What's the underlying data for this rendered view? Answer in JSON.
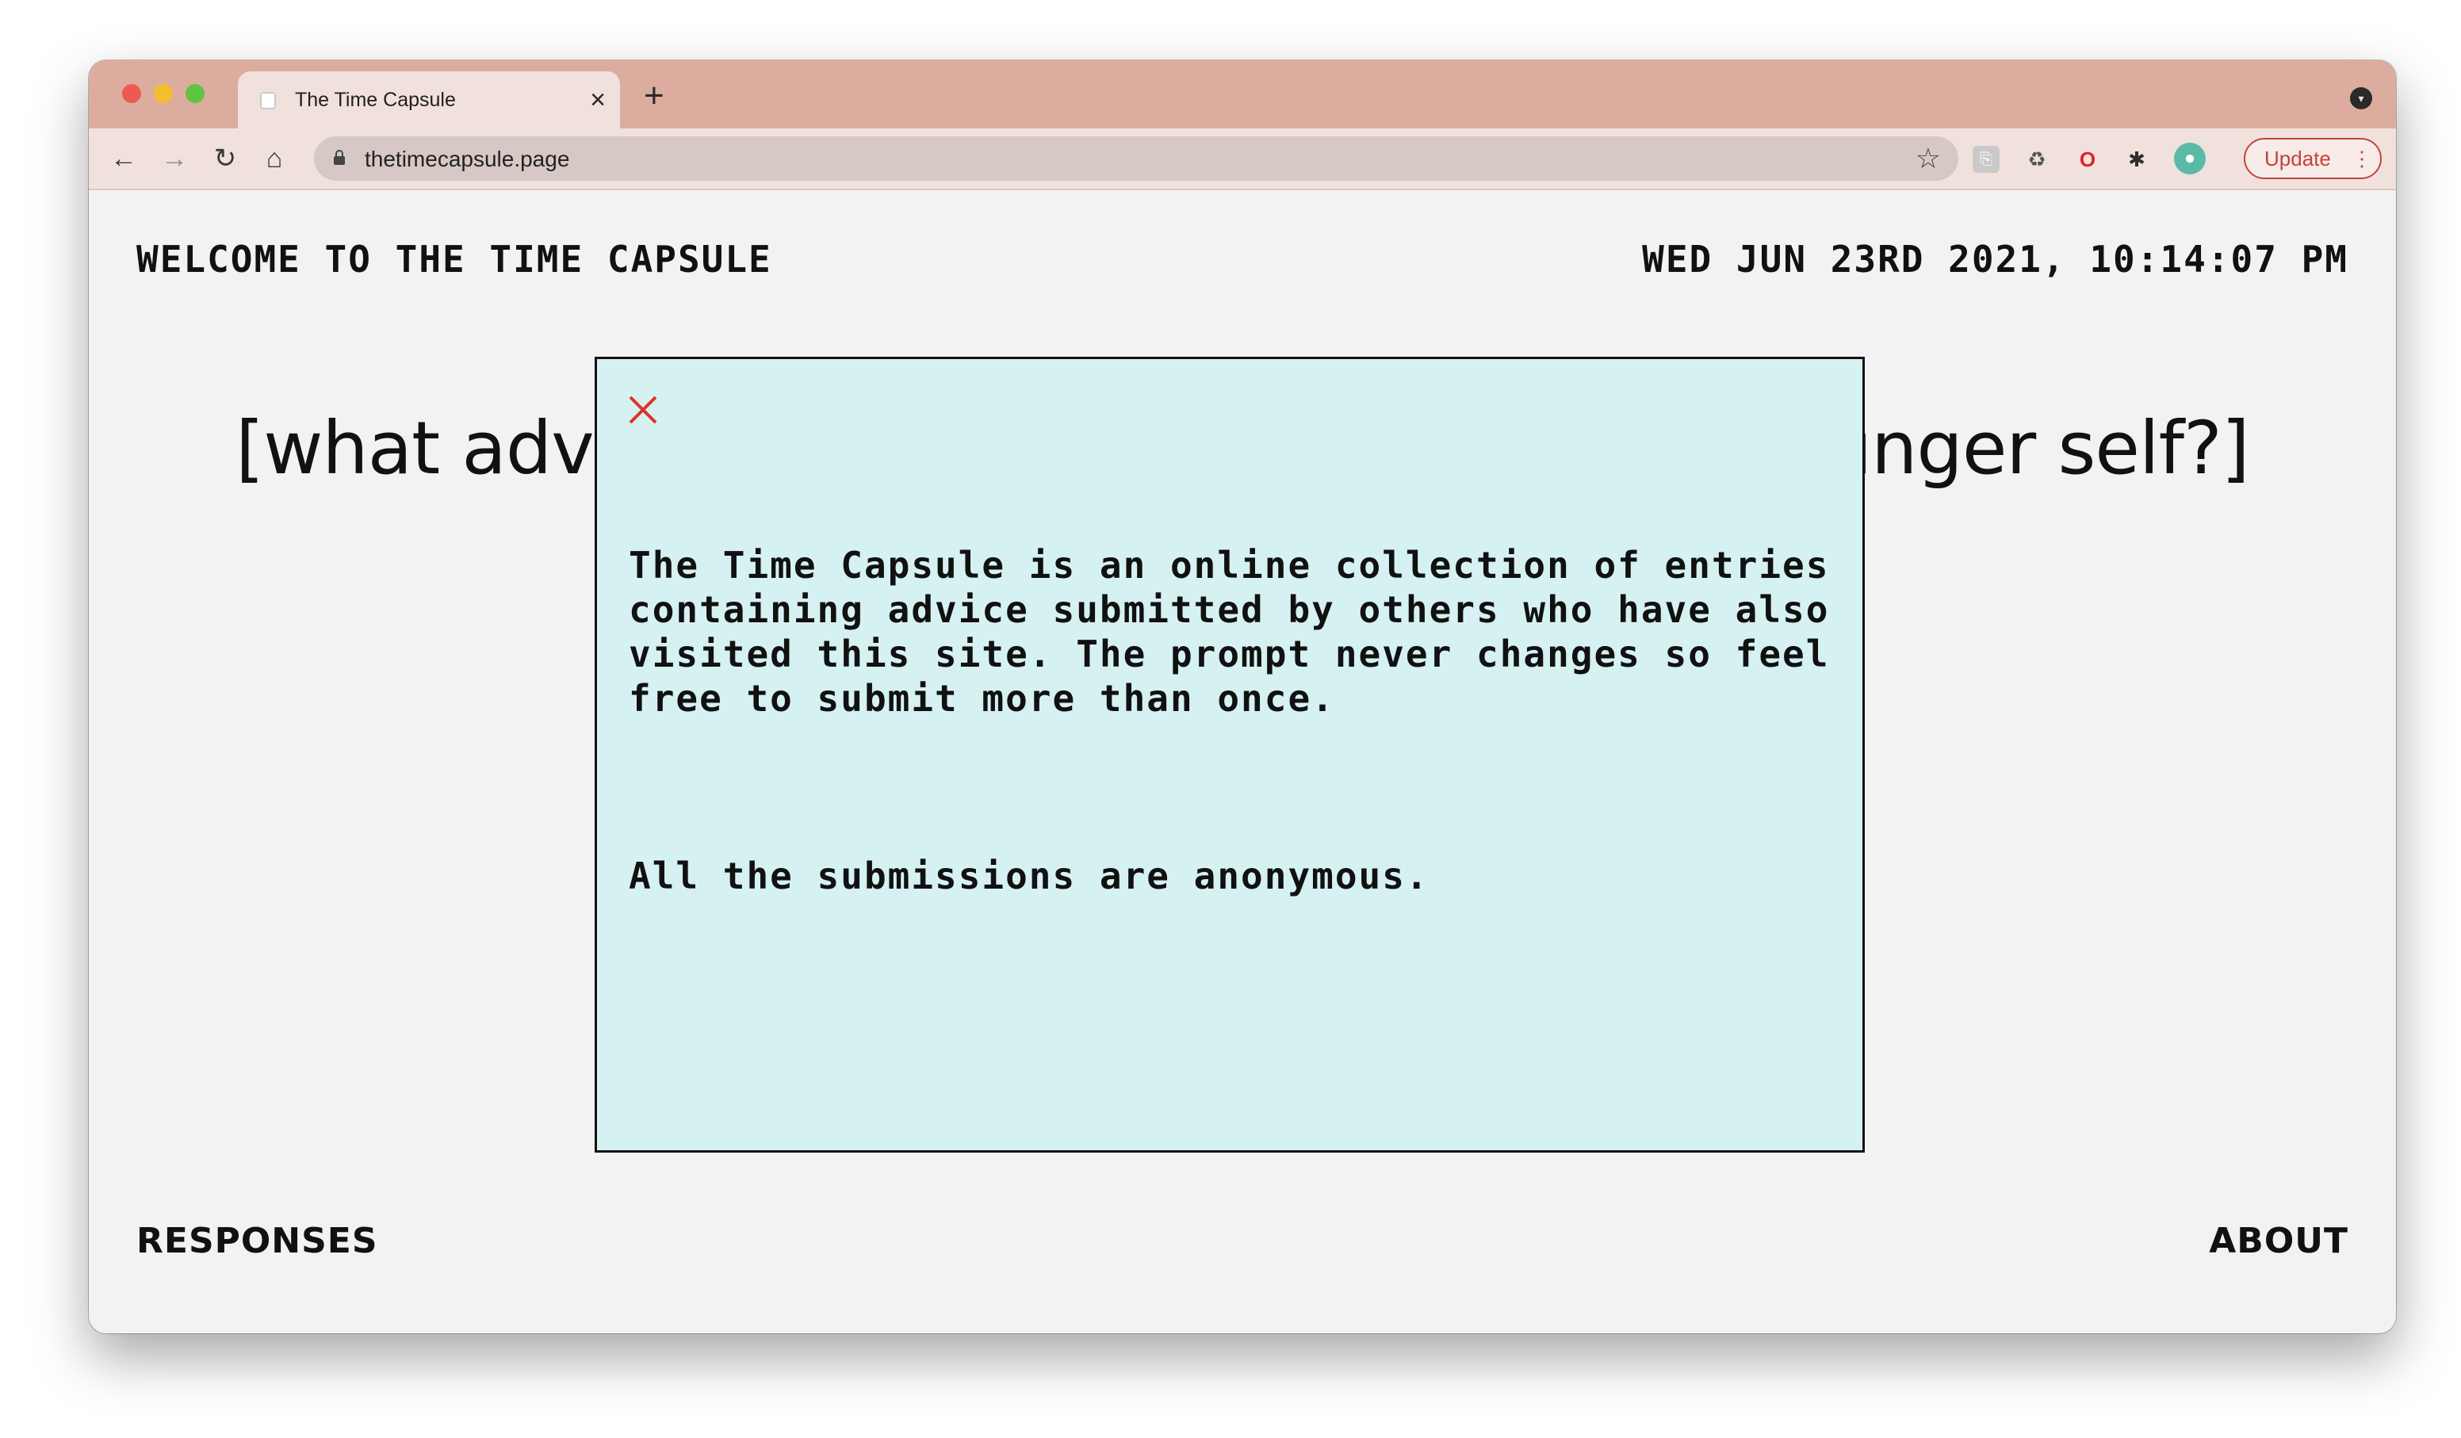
{
  "browser": {
    "tab_title": "The Time Capsule",
    "tab_close": "×",
    "new_tab": "+",
    "url": "thetimecapsule.page",
    "update_label": "Update",
    "update_menu": "⋮"
  },
  "page": {
    "title": "WELCOME TO THE TIME CAPSULE",
    "datetime": "WED JUN 23RD 2021, 10:14:07 PM",
    "prompt_left": "[what advic",
    "prompt_right": "unger self?]",
    "footer_left": "RESPONSES",
    "footer_right": "ABOUT"
  },
  "modal": {
    "paragraph_1": "The Time Capsule is an online collection of entries containing advice submitted by others who have also visited this site. The prompt never changes so feel free to submit more than once.",
    "paragraph_2": "All the submissions are anonymous."
  },
  "colors": {
    "tabstrip": "#dcad9f",
    "toolbar": "#f1e1dc",
    "page_background": "#f2f2f4",
    "modal_background": "#d6f1f1",
    "close_icon": "#d9352b",
    "update_accent": "#c5433a"
  },
  "icons": [
    "back-icon",
    "forward-icon",
    "reload-icon",
    "home-icon",
    "lock-icon",
    "star-icon",
    "extension-icon",
    "puzzle-icon",
    "close-icon"
  ]
}
